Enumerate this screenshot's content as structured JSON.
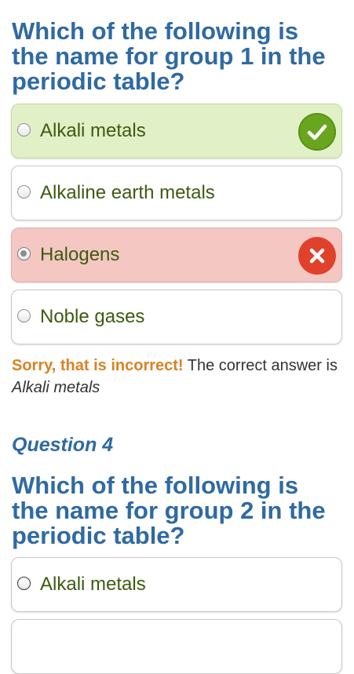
{
  "question3": {
    "text": "Which of the following is the name for group 1 in the periodic table?",
    "options": [
      {
        "label": "Alkali metals",
        "state": "correct"
      },
      {
        "label": "Alkaline earth metals",
        "state": "none"
      },
      {
        "label": "Halogens",
        "state": "wrong"
      },
      {
        "label": "Noble gases",
        "state": "none"
      }
    ],
    "feedback": {
      "sorry": "Sorry, that is incorrect!",
      "message": " The correct answer is",
      "answer": "Alkali metals"
    }
  },
  "question4": {
    "number_label": "Question 4",
    "text": "Which of the following is the name for group 2 in the periodic table?",
    "options": [
      {
        "label": "Alkali metals"
      }
    ]
  },
  "icons": {
    "correct": "checkmark-icon",
    "wrong": "close-icon"
  },
  "colors": {
    "question_text": "#2f6aa3",
    "option_text": "#3d5a10",
    "correct_bg": "#e2f0c8",
    "wrong_bg": "#f4c7c2",
    "correct_badge": "#6aa51f",
    "wrong_badge": "#e0412b",
    "sorry_text": "#d98223"
  }
}
